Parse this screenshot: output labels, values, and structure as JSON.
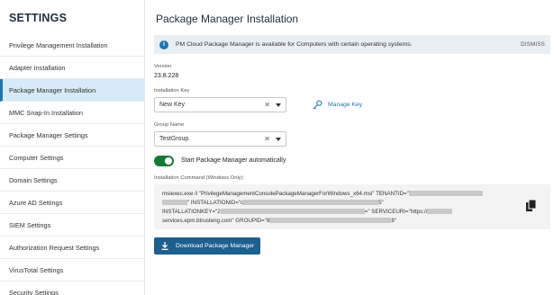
{
  "sidebar": {
    "title": "SETTINGS",
    "items": [
      {
        "label": "Privilege Management Installation"
      },
      {
        "label": "Adapter Installation"
      },
      {
        "label": "Package Manager Installation"
      },
      {
        "label": "MMC Snap-In Installation"
      },
      {
        "label": "Package Manager Settings"
      },
      {
        "label": "Computer Settings"
      },
      {
        "label": "Domain Settings"
      },
      {
        "label": "Azure AD Settings"
      },
      {
        "label": "SIEM Settings"
      },
      {
        "label": "Authorization Request Settings"
      },
      {
        "label": "VirusTotal Settings"
      },
      {
        "label": "Security Settings"
      }
    ],
    "active_index": 2
  },
  "main": {
    "title": "Package Manager Installation",
    "banner": {
      "icon": "info-icon",
      "text": "PM Cloud Package Manager is available for Computers with certain operating systems.",
      "dismiss": "DISMISS"
    },
    "version": {
      "label": "Version",
      "value": "23.8.228"
    },
    "installation_key": {
      "label": "Installation Key",
      "value": "New Key",
      "manage_label": "Manage Key"
    },
    "group_name": {
      "label": "Group Name",
      "value": "TestGroup."
    },
    "auto_start": {
      "label": "Start Package Manager automatically",
      "enabled": true
    },
    "command": {
      "label": "Installation Command (Windows Only):",
      "line1": "msiexec.exe /i \"PrivilegeManagementConsolePackageManagerForWindows_x64.msi\" TENANTID=\"",
      "line2a": "\" INSTALLATIONID=\"c",
      "line2b": "5\"",
      "line3a": "INSTALLATIONKEY=\"2",
      "line3b": "=\" SERVICEURI=\"https://",
      "line4a": "services.epm.btrusteng.com\" GROUPID=\"8",
      "line4b": "8\""
    },
    "download_label": "Download Package Manager"
  },
  "colors": {
    "accent": "#1d78b0",
    "toggle_on": "#137a36",
    "button": "#1d5f8e",
    "active_bg": "#d6eaf8"
  }
}
